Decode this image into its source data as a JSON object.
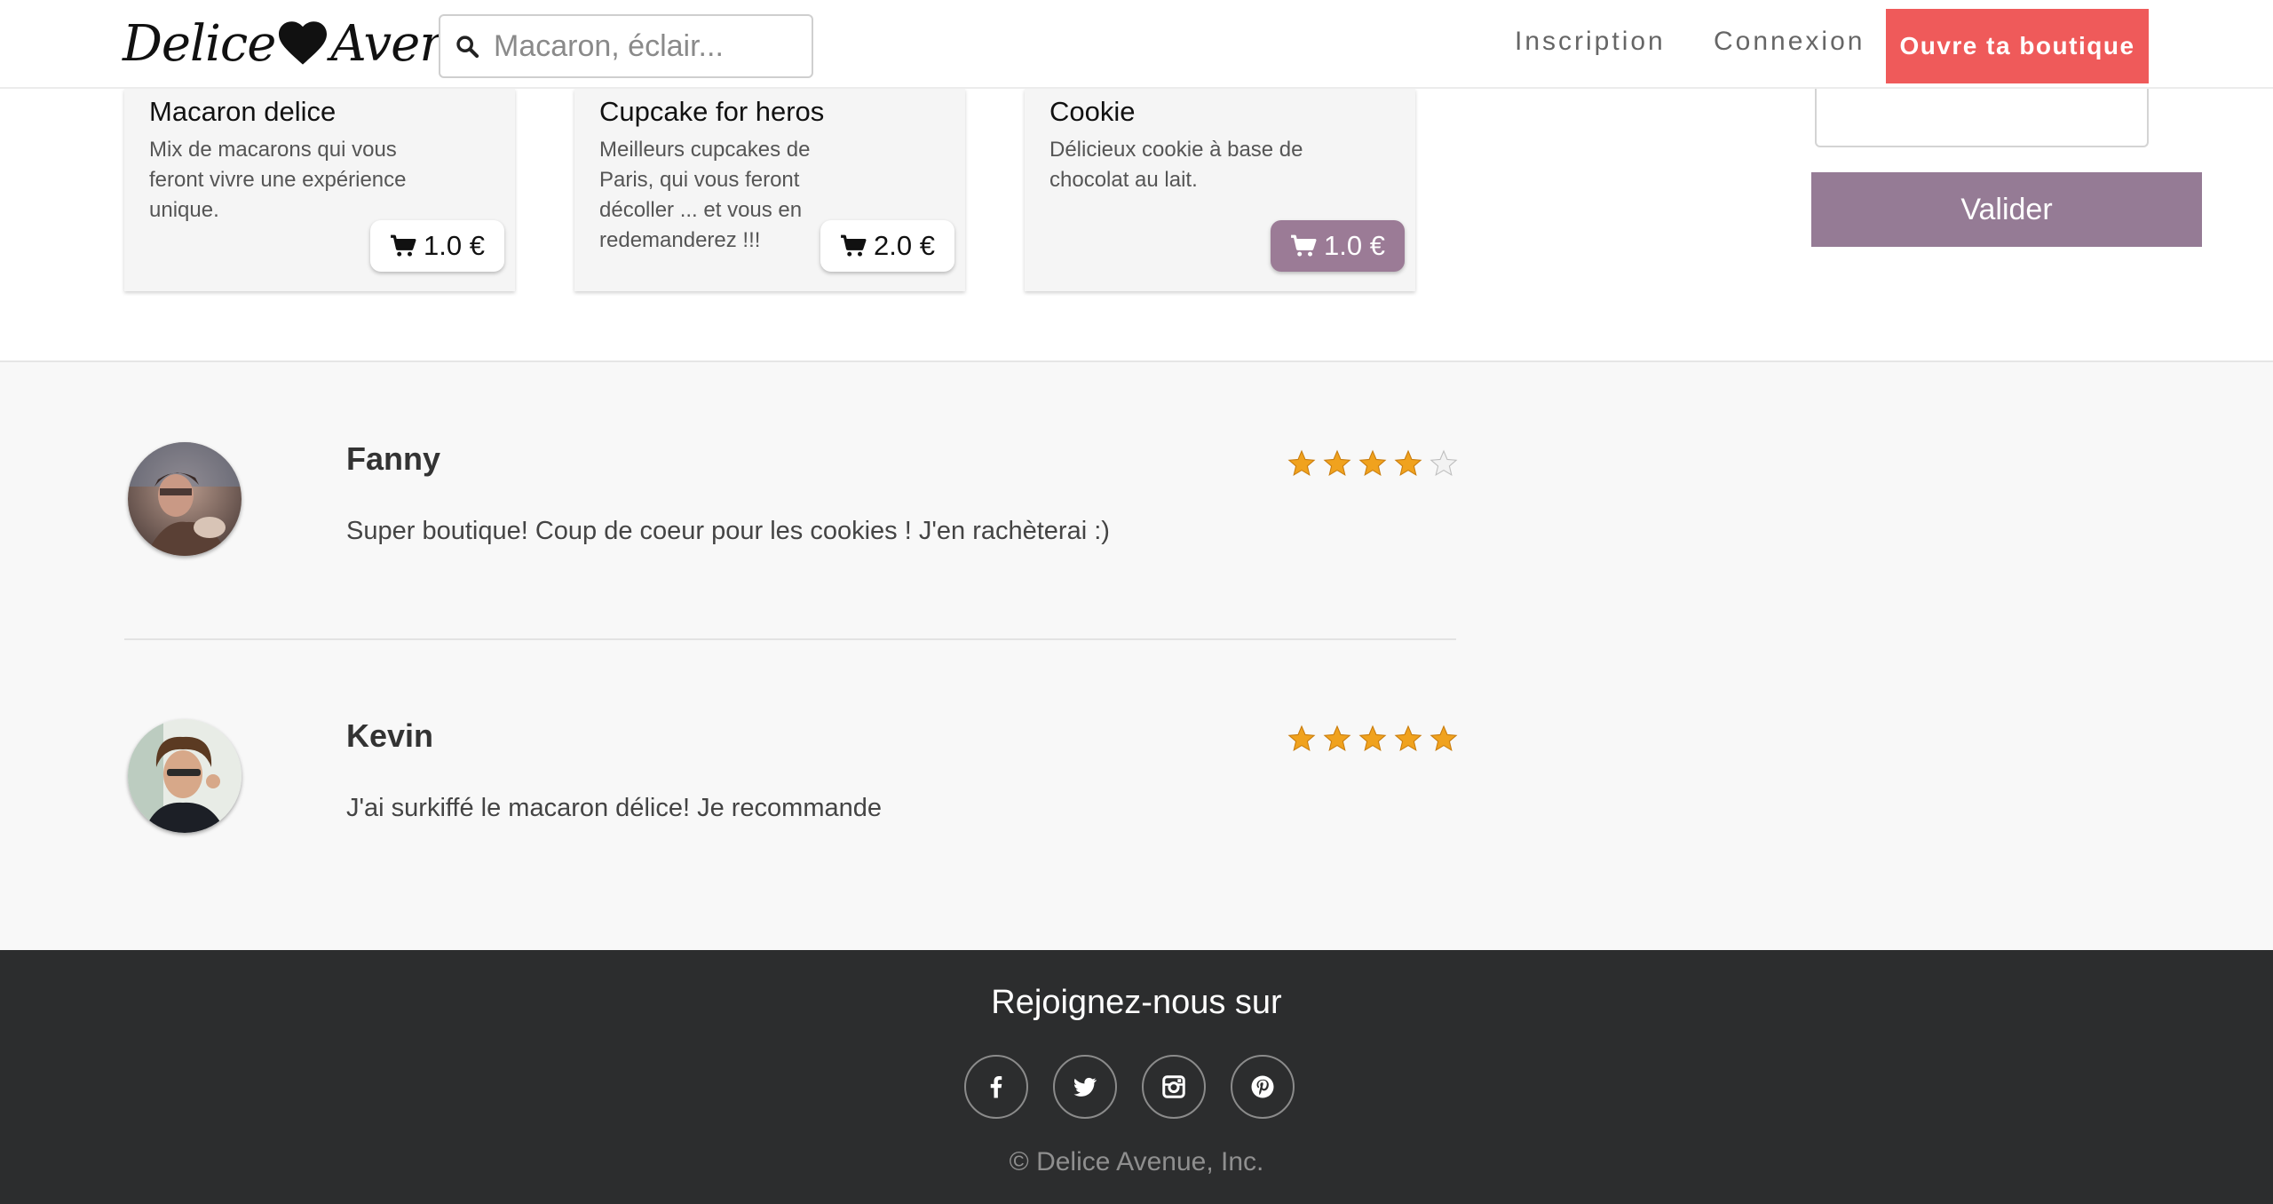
{
  "header": {
    "logo": {
      "part1": "Delice",
      "part2": "Avenue"
    },
    "search_placeholder": "Macaron, éclair...",
    "nav": {
      "register": "Inscription",
      "login": "Connexion",
      "open_shop": "Ouvre ta boutique"
    }
  },
  "products": [
    {
      "title": "Macaron delice",
      "description": "Mix de macarons qui vous feront vivre une expérience unique.",
      "price": "1.0 €"
    },
    {
      "title": "Cupcake for heros",
      "description": "Meilleurs cupcakes de Paris, qui vous feront décoller ... et vous en redemanderez !!!",
      "price": "2.0 €"
    },
    {
      "title": "Cookie",
      "description": "Délicieux cookie à base de chocolat au lait.",
      "price": "1.0 €"
    }
  ],
  "sidebar": {
    "validate_label": "Valider"
  },
  "reviews": [
    {
      "name": "Fanny",
      "text": "Super boutique! Coup de coeur pour les cookies ! J'en rachèterai :)",
      "rating": 4,
      "max_rating": 5
    },
    {
      "name": "Kevin",
      "text": "J'ai surkiffé le macaron délice! Je recommande",
      "rating": 5,
      "max_rating": 5
    }
  ],
  "footer": {
    "join_text": "Rejoignez-nous sur",
    "socials": [
      "facebook-icon",
      "twitter-icon",
      "instagram-icon",
      "pinterest-icon"
    ],
    "copyright": "© Delice Avenue, Inc."
  },
  "colors": {
    "cta": "#ef5a5a",
    "accent": "#957b95",
    "footer": "#2c2d2e",
    "star": "#f0a21e"
  }
}
